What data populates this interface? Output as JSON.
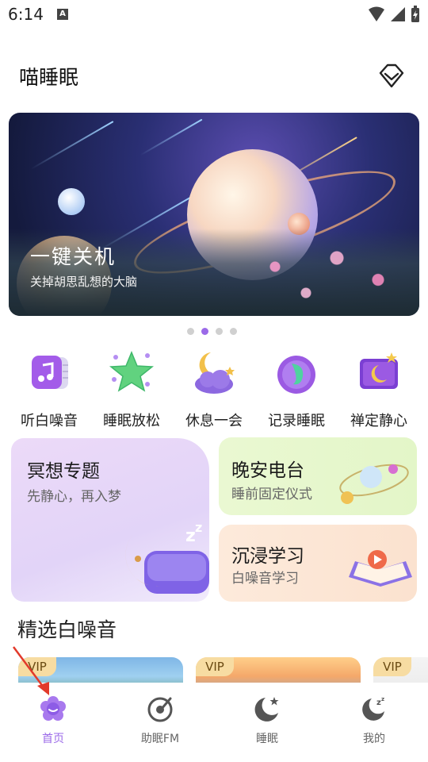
{
  "status": {
    "time": "6:14",
    "indicator": "A"
  },
  "header": {
    "title": "喵睡眠",
    "vip_icon": "diamond-icon"
  },
  "banner": {
    "title": "一键关机",
    "subtitle": "关掉胡思乱想的大脑",
    "page_index": 2,
    "page_count": 4
  },
  "categories": [
    {
      "label": "听白噪音",
      "icon": "music-note-icon"
    },
    {
      "label": "睡眠放松",
      "icon": "star-icon"
    },
    {
      "label": "休息一会",
      "icon": "moon-cloud-icon"
    },
    {
      "label": "记录睡眠",
      "icon": "sleep-record-icon"
    },
    {
      "label": "禅定静心",
      "icon": "moon-frame-icon"
    }
  ],
  "cards": {
    "meditation": {
      "title": "冥想专题",
      "subtitle": "先静心，再入梦"
    },
    "radio": {
      "title": "晚安电台",
      "subtitle": "睡前固定仪式"
    },
    "study": {
      "title": "沉浸学习",
      "subtitle": "白噪音学习"
    }
  },
  "section": {
    "title": "精选白噪音"
  },
  "thumbs": [
    {
      "badge": "VIP"
    },
    {
      "badge": "VIP"
    },
    {
      "badge": "VIP"
    }
  ],
  "bottom_nav": [
    {
      "label": "首页",
      "icon": "home-flower-icon",
      "active": true
    },
    {
      "label": "助眠FM",
      "icon": "fm-disc-icon",
      "active": false
    },
    {
      "label": "睡眠",
      "icon": "moon-star-icon",
      "active": false
    },
    {
      "label": "我的",
      "icon": "profile-moon-icon",
      "active": false
    }
  ],
  "colors": {
    "accent": "#9b6ae8",
    "vip_badge": "#f7dca2"
  }
}
